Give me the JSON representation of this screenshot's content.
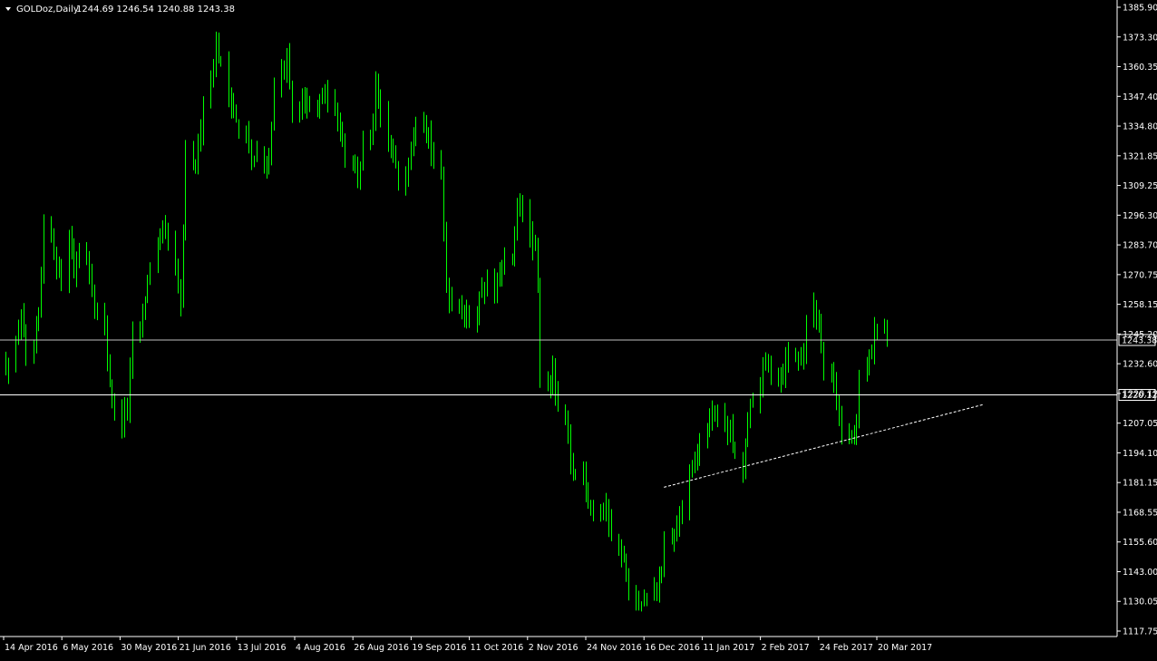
{
  "header": {
    "symbol": "GOLDoz,Daily",
    "ohlc": "1244.69 1246.54 1240.88 1243.38"
  },
  "colors": {
    "background": "#000000",
    "candle": "#00ff00",
    "axis": "#ffffff",
    "text": "#ffffff",
    "current_price_line": "#c0c0c0",
    "level_line": "#ffffff",
    "trendline": "#ffffff"
  },
  "chart_data": {
    "type": "candlestick",
    "ylim": [
      1117.75,
      1385.9
    ],
    "y_ticks": [
      "1385.90",
      "1373.30",
      "1360.35",
      "1347.40",
      "1334.80",
      "1321.85",
      "1309.25",
      "1296.30",
      "1283.70",
      "1270.75",
      "1258.15",
      "1245.20",
      "1232.60",
      "1220.12",
      "1207.05",
      "1194.10",
      "1181.15",
      "1168.55",
      "1155.60",
      "1143.00",
      "1130.05",
      "1117.75"
    ],
    "x_ticks": [
      "14 Apr 2016",
      "6 May 2016",
      "30 May 2016",
      "21 Jun 2016",
      "13 Jul 2016",
      "4 Aug 2016",
      "26 Aug 2016",
      "19 Sep 2016",
      "11 Oct 2016",
      "2 Nov 2016",
      "24 Nov 2016",
      "16 Dec 2016",
      "11 Jan 2017",
      "2 Feb 2017",
      "24 Feb 2017",
      "20 Mar 2017"
    ],
    "current_price": "1243.38",
    "level_price": "1220.12",
    "trendline": [
      {
        "date": "2016-12-30",
        "price": 1181
      },
      {
        "date": "2017-03-23",
        "price": 1216
      }
    ],
    "close_path": [
      [
        "2016-04-14",
        1232
      ],
      [
        "2016-04-18",
        1240
      ],
      [
        "2016-04-20",
        1255
      ],
      [
        "2016-04-22",
        1234
      ],
      [
        "2016-04-25",
        1238
      ],
      [
        "2016-04-27",
        1252
      ],
      [
        "2016-04-29",
        1290
      ],
      [
        "2016-05-02",
        1288
      ],
      [
        "2016-05-04",
        1276
      ],
      [
        "2016-05-06",
        1268
      ],
      [
        "2016-05-09",
        1290
      ],
      [
        "2016-05-11",
        1272
      ],
      [
        "2016-05-13",
        1280
      ],
      [
        "2016-05-16",
        1280
      ],
      [
        "2016-05-18",
        1265
      ],
      [
        "2016-05-20",
        1252
      ],
      [
        "2016-05-23",
        1248
      ],
      [
        "2016-05-25",
        1226
      ],
      [
        "2016-05-27",
        1212
      ],
      [
        "2016-05-30",
        1208
      ],
      [
        "2016-06-01",
        1215
      ],
      [
        "2016-06-03",
        1244
      ],
      [
        "2016-06-06",
        1248
      ],
      [
        "2016-06-08",
        1262
      ],
      [
        "2016-06-10",
        1276
      ],
      [
        "2016-06-13",
        1282
      ],
      [
        "2016-06-15",
        1290
      ],
      [
        "2016-06-17",
        1285
      ],
      [
        "2016-06-20",
        1270
      ],
      [
        "2016-06-22",
        1258
      ],
      [
        "2016-06-24",
        1322
      ],
      [
        "2016-06-27",
        1315
      ],
      [
        "2016-06-29",
        1325
      ],
      [
        "2016-07-01",
        1345
      ],
      [
        "2016-07-04",
        1355
      ],
      [
        "2016-07-06",
        1368
      ],
      [
        "2016-07-08",
        1360
      ],
      [
        "2016-07-11",
        1348
      ],
      [
        "2016-07-13",
        1342
      ],
      [
        "2016-07-15",
        1330
      ],
      [
        "2016-07-18",
        1330
      ],
      [
        "2016-07-20",
        1318
      ],
      [
        "2016-07-22",
        1322
      ],
      [
        "2016-07-25",
        1316
      ],
      [
        "2016-07-27",
        1322
      ],
      [
        "2016-07-29",
        1350
      ],
      [
        "2016-08-01",
        1357
      ],
      [
        "2016-08-03",
        1362
      ],
      [
        "2016-08-05",
        1337
      ],
      [
        "2016-08-08",
        1340
      ],
      [
        "2016-08-10",
        1345
      ],
      [
        "2016-08-12",
        1342
      ],
      [
        "2016-08-15",
        1340
      ],
      [
        "2016-08-17",
        1348
      ],
      [
        "2016-08-19",
        1347
      ],
      [
        "2016-08-22",
        1338
      ],
      [
        "2016-08-24",
        1335
      ],
      [
        "2016-08-26",
        1322
      ],
      [
        "2016-08-29",
        1322
      ],
      [
        "2016-08-31",
        1312
      ],
      [
        "2016-09-02",
        1326
      ],
      [
        "2016-09-05",
        1327
      ],
      [
        "2016-09-07",
        1349
      ],
      [
        "2016-09-09",
        1336
      ],
      [
        "2016-09-12",
        1325
      ],
      [
        "2016-09-14",
        1322
      ],
      [
        "2016-09-16",
        1310
      ],
      [
        "2016-09-19",
        1314
      ],
      [
        "2016-09-21",
        1328
      ],
      [
        "2016-09-23",
        1338
      ],
      [
        "2016-09-26",
        1340
      ],
      [
        "2016-09-28",
        1330
      ],
      [
        "2016-09-30",
        1318
      ],
      [
        "2016-10-03",
        1312
      ],
      [
        "2016-10-05",
        1268
      ],
      [
        "2016-10-07",
        1258
      ],
      [
        "2016-10-10",
        1260
      ],
      [
        "2016-10-12",
        1255
      ],
      [
        "2016-10-14",
        1252
      ],
      [
        "2016-10-17",
        1255
      ],
      [
        "2016-10-19",
        1267
      ],
      [
        "2016-10-21",
        1266
      ],
      [
        "2016-10-24",
        1265
      ],
      [
        "2016-10-26",
        1270
      ],
      [
        "2016-10-28",
        1275
      ],
      [
        "2016-10-31",
        1278
      ],
      [
        "2016-11-02",
        1298
      ],
      [
        "2016-11-04",
        1302
      ],
      [
        "2016-11-07",
        1285
      ],
      [
        "2016-11-09",
        1280
      ],
      [
        "2016-11-10",
        1265
      ],
      [
        "2016-11-11",
        1228
      ],
      [
        "2016-11-14",
        1225
      ],
      [
        "2016-11-16",
        1230
      ],
      [
        "2016-11-18",
        1212
      ],
      [
        "2016-11-21",
        1210
      ],
      [
        "2016-11-23",
        1190
      ],
      [
        "2016-11-25",
        1186
      ],
      [
        "2016-11-28",
        1189
      ],
      [
        "2016-11-30",
        1175
      ],
      [
        "2016-12-02",
        1173
      ],
      [
        "2016-12-05",
        1170
      ],
      [
        "2016-12-07",
        1172
      ],
      [
        "2016-12-09",
        1162
      ],
      [
        "2016-12-12",
        1155
      ],
      [
        "2016-12-14",
        1150
      ],
      [
        "2016-12-16",
        1135
      ],
      [
        "2016-12-19",
        1133
      ],
      [
        "2016-12-21",
        1130
      ],
      [
        "2016-12-23",
        1133
      ],
      [
        "2016-12-26",
        1136
      ],
      [
        "2016-12-28",
        1142
      ],
      [
        "2016-12-30",
        1155
      ],
      [
        "2017-01-03",
        1160
      ],
      [
        "2017-01-05",
        1170
      ],
      [
        "2017-01-09",
        1185
      ],
      [
        "2017-01-11",
        1192
      ],
      [
        "2017-01-13",
        1200
      ],
      [
        "2017-01-17",
        1210
      ],
      [
        "2017-01-19",
        1212
      ],
      [
        "2017-01-23",
        1208
      ],
      [
        "2017-01-25",
        1205
      ],
      [
        "2017-01-27",
        1192
      ],
      [
        "2017-01-30",
        1188
      ],
      [
        "2017-01-31",
        1200
      ],
      [
        "2017-02-02",
        1215
      ],
      [
        "2017-02-06",
        1225
      ],
      [
        "2017-02-08",
        1235
      ],
      [
        "2017-02-10",
        1232
      ],
      [
        "2017-02-13",
        1228
      ],
      [
        "2017-02-15",
        1230
      ],
      [
        "2017-02-17",
        1238
      ],
      [
        "2017-02-21",
        1236
      ],
      [
        "2017-02-23",
        1240
      ],
      [
        "2017-02-24",
        1250
      ],
      [
        "2017-02-27",
        1258
      ],
      [
        "2017-03-01",
        1250
      ],
      [
        "2017-03-03",
        1234
      ],
      [
        "2017-03-06",
        1232
      ],
      [
        "2017-03-08",
        1218
      ],
      [
        "2017-03-10",
        1205
      ],
      [
        "2017-03-13",
        1202
      ],
      [
        "2017-03-15",
        1200
      ],
      [
        "2017-03-16",
        1210
      ],
      [
        "2017-03-17",
        1226
      ],
      [
        "2017-03-20",
        1232
      ],
      [
        "2017-03-22",
        1240
      ],
      [
        "2017-03-24",
        1250
      ],
      [
        "2017-03-27",
        1249
      ],
      [
        "2017-03-28",
        1243.38
      ]
    ]
  }
}
